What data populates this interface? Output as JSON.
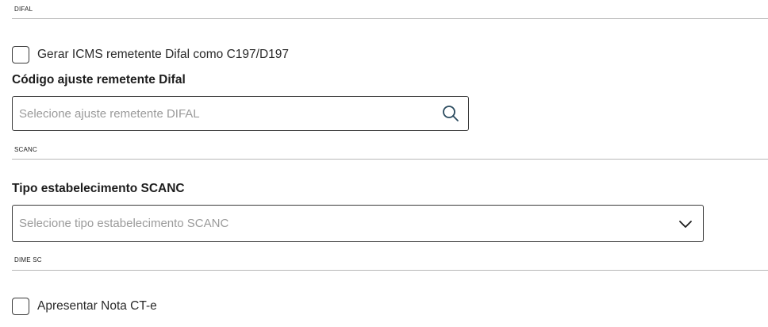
{
  "sections": {
    "difal": {
      "title": "DIFAL",
      "checkbox_label": "Gerar ICMS remetente Difal como C197/D197",
      "checkbox_checked": false,
      "field_label": "Código ajuste remetente Difal",
      "field_placeholder": "Selecione ajuste remetente DIFAL",
      "field_icon": "search-icon"
    },
    "scanc": {
      "title": "SCANC",
      "field_label": "Tipo estabelecimento SCANC",
      "field_placeholder": "Selecione tipo estabelecimento SCANC",
      "field_icon": "chevron-down-icon"
    },
    "dime_sc": {
      "title": "DIME SC",
      "checkbox_label": "Apresentar Nota CT-e",
      "checkbox_checked": false
    }
  },
  "colors": {
    "accent_icon": "#2a4a5e",
    "border": "#3a3a3a",
    "divider": "#b8b8b8",
    "placeholder": "#9a9a9a"
  }
}
